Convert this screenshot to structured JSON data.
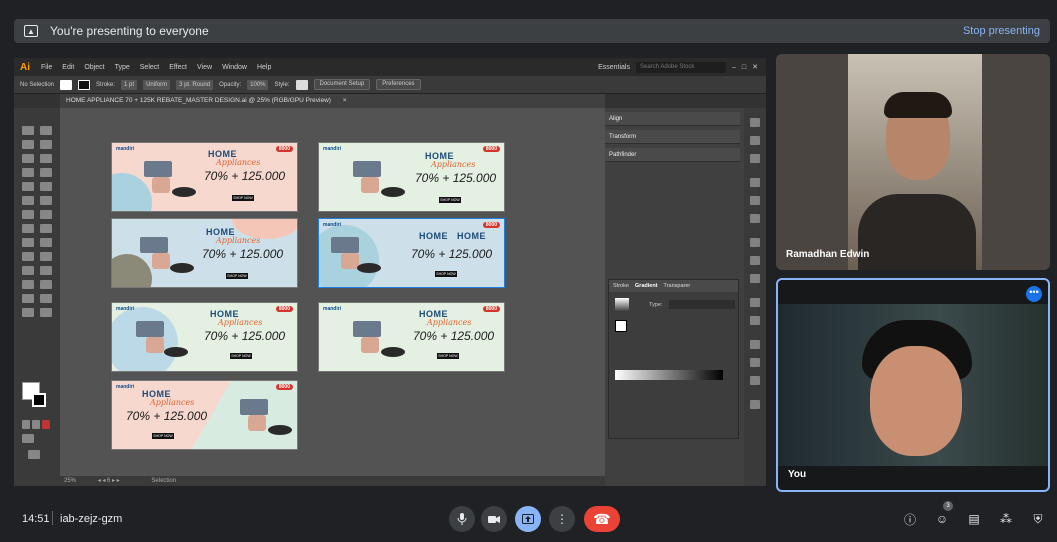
{
  "banner": {
    "text": "You're presenting to everyone",
    "stop_label": "Stop presenting"
  },
  "illustrator": {
    "logo": "Ai",
    "menu": [
      "File",
      "Edit",
      "Object",
      "Type",
      "Select",
      "Effect",
      "View",
      "Window",
      "Help"
    ],
    "workspace": "Essentials",
    "search_placeholder": "Search Adobe Stock",
    "ctrl": {
      "selection": "No Selection",
      "stroke_label": "Stroke:",
      "stroke_weight": "1 pt",
      "uniform": "Uniform",
      "brush": "3 pt. Round",
      "opacity_label": "Opacity:",
      "opacity": "100%",
      "style_label": "Style:",
      "doc_setup": "Document Setup",
      "preferences": "Preferences"
    },
    "doc_tab": "HOME APPLIANCE 70 + 125K REBATE_MASTER DESIGN.ai @ 25% (RGB/GPU Preview)",
    "zoom": "25%",
    "status_tool": "Selection",
    "panels": {
      "align": "Align",
      "transform": "Transform",
      "pathfinder": "Pathfinder"
    },
    "gradient_tabs": [
      "Stroke",
      "Gradient",
      "Transparer"
    ],
    "gradient_type": "Type:",
    "artboard_text": {
      "logo": "mandiri",
      "badge": "8000",
      "home": "HOME",
      "appliances": "Appliances",
      "price": "70% + 125.000",
      "shop": "SHOP NOW"
    }
  },
  "participants": [
    {
      "name": "Ramadhan Edwin"
    },
    {
      "name": "You"
    }
  ],
  "bottom": {
    "clock": "14:51",
    "meeting_code": "iab-zejz-gzm",
    "people_count": "3",
    "icons": {
      "mic": "microphone-icon",
      "cam": "camera-icon",
      "present": "present-icon",
      "more": "more-vert-icon",
      "end": "end-call-icon",
      "info": "info-icon",
      "people": "people-icon",
      "chat": "chat-icon",
      "activities": "activities-icon",
      "safety": "host-controls-icon"
    }
  }
}
